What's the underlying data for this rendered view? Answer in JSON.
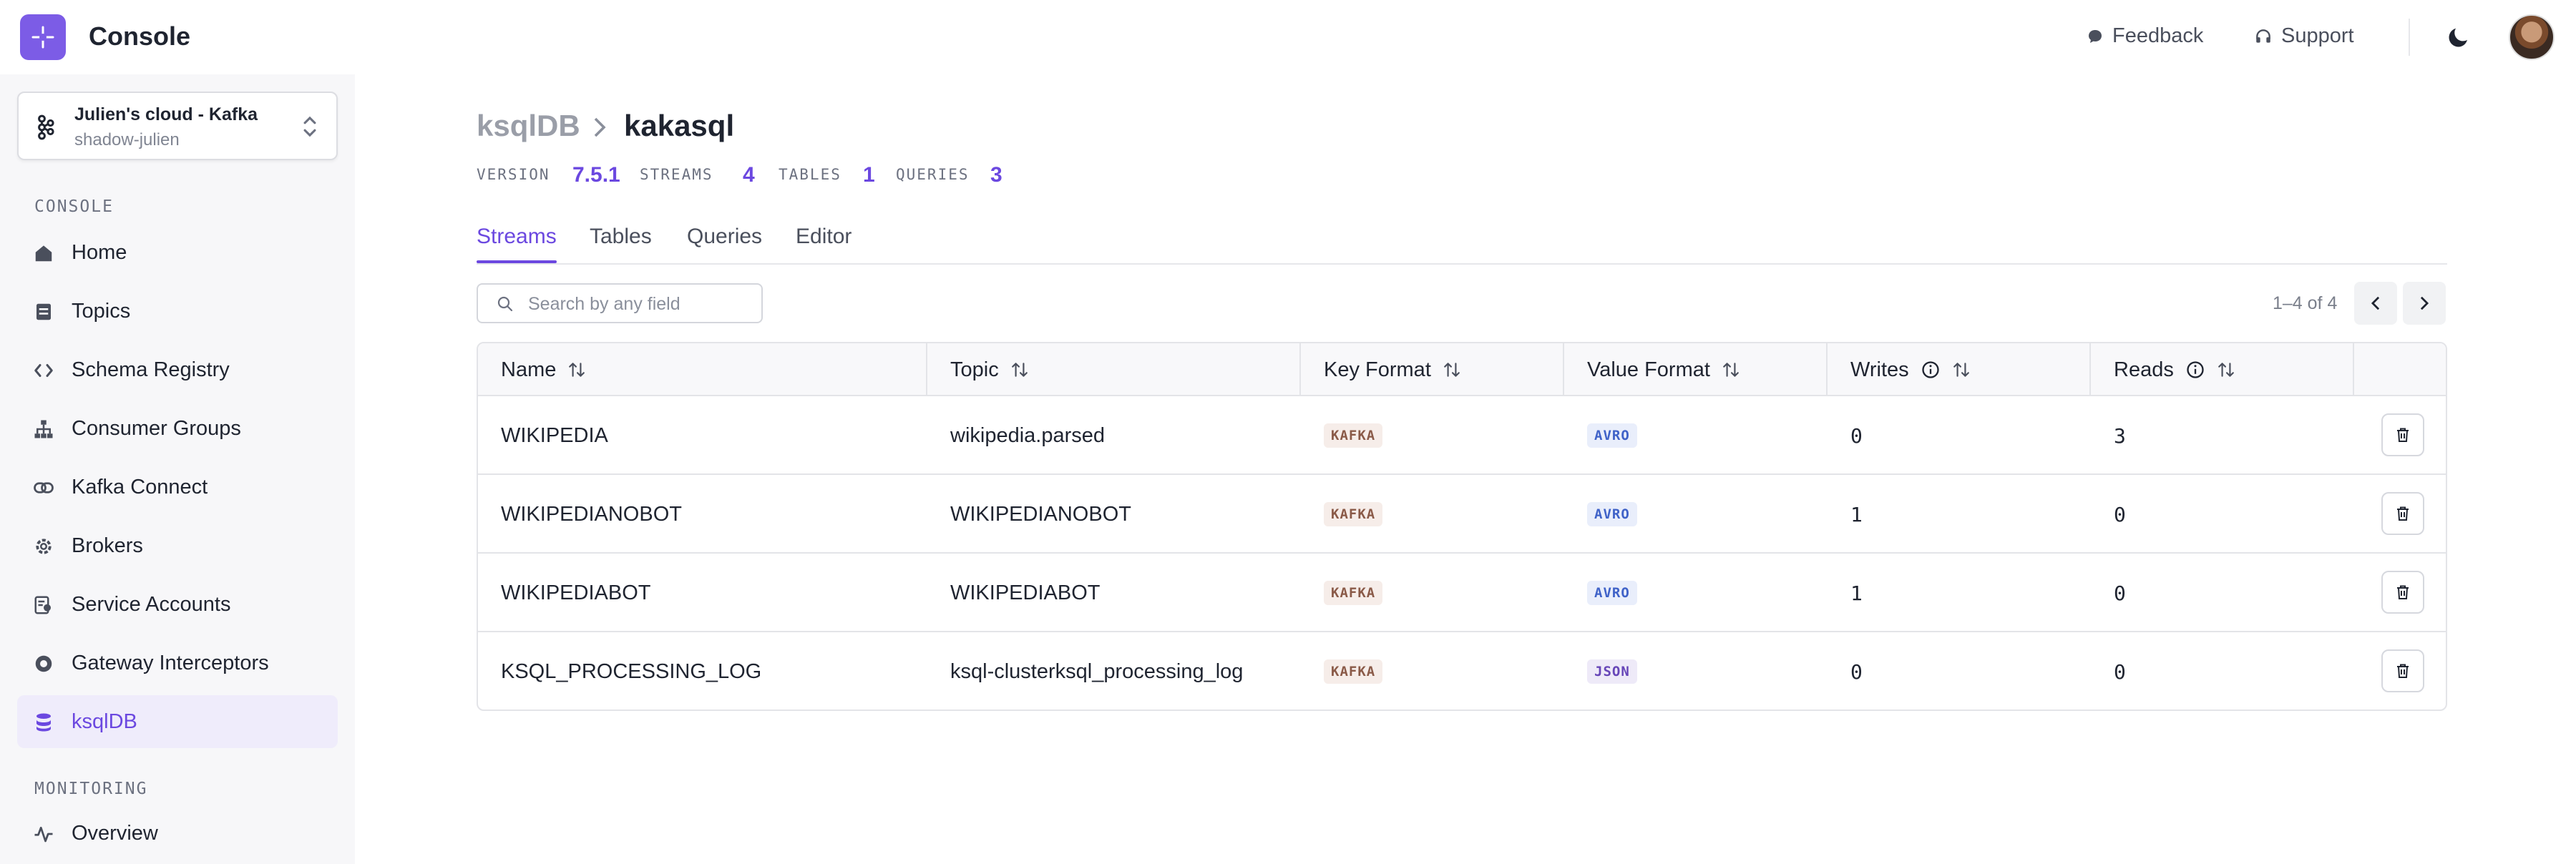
{
  "app": {
    "title": "Console",
    "brand_color": "#7c5ce6",
    "accent_color": "#6b48e0"
  },
  "topbar": {
    "feedback_label": "Feedback",
    "support_label": "Support",
    "theme_icon": "moon-icon",
    "avatar": "user-avatar"
  },
  "sidebar": {
    "cluster": {
      "name": "Julien's cloud - Kafka",
      "sub": "shadow-julien"
    },
    "console_section": "CONSOLE",
    "items": [
      {
        "label": "Home",
        "icon": "home-icon"
      },
      {
        "label": "Topics",
        "icon": "topics-icon"
      },
      {
        "label": "Schema Registry",
        "icon": "code-icon"
      },
      {
        "label": "Consumer Groups",
        "icon": "hierarchy-icon"
      },
      {
        "label": "Kafka Connect",
        "icon": "link-icon"
      },
      {
        "label": "Brokers",
        "icon": "gear-icon"
      },
      {
        "label": "Service Accounts",
        "icon": "account-icon"
      },
      {
        "label": "Gateway Interceptors",
        "icon": "interceptor-icon"
      },
      {
        "label": "ksqlDB",
        "icon": "database-icon",
        "active": true
      }
    ],
    "monitoring_section": "MONITORING",
    "monitoring_items": [
      {
        "label": "Overview",
        "icon": "pulse-icon"
      }
    ]
  },
  "breadcrumb": {
    "parent": "ksqlDB",
    "current": "kakasql"
  },
  "meta": {
    "version_label": "VERSION",
    "version": "7.5.1",
    "streams_label": "STREAMS",
    "streams": "4",
    "tables_label": "TABLES",
    "tables": "1",
    "queries_label": "QUERIES",
    "queries": "3"
  },
  "tabs": [
    {
      "label": "Streams",
      "active": true
    },
    {
      "label": "Tables"
    },
    {
      "label": "Queries"
    },
    {
      "label": "Editor"
    }
  ],
  "search": {
    "placeholder": "Search by any field",
    "value": ""
  },
  "pager": {
    "text": "1–4 of 4"
  },
  "table": {
    "columns": [
      "Name",
      "Topic",
      "Key Format",
      "Value Format",
      "Writes",
      "Reads"
    ],
    "rows": [
      {
        "name": "WIKIPEDIA",
        "topic": "wikipedia.parsed",
        "key_format": "KAFKA",
        "value_format": "AVRO",
        "writes": "0",
        "reads": "3"
      },
      {
        "name": "WIKIPEDIANOBOT",
        "topic": "WIKIPEDIANOBOT",
        "key_format": "KAFKA",
        "value_format": "AVRO",
        "writes": "1",
        "reads": "0"
      },
      {
        "name": "WIKIPEDIABOT",
        "topic": "WIKIPEDIABOT",
        "key_format": "KAFKA",
        "value_format": "AVRO",
        "writes": "1",
        "reads": "0"
      },
      {
        "name": "KSQL_PROCESSING_LOG",
        "topic": "ksql-clusterksql_processing_log",
        "key_format": "KAFKA",
        "value_format": "JSON",
        "writes": "0",
        "reads": "0"
      }
    ]
  }
}
